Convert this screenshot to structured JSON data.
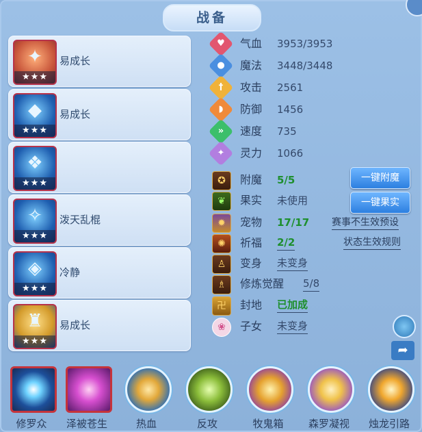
{
  "title": "战备",
  "equipment": [
    {
      "label": "易成长",
      "stars": "★★★"
    },
    {
      "label": "易成长",
      "stars": "★★★"
    },
    {
      "label": "",
      "stars": "★★★"
    },
    {
      "label": "泼天乱棍",
      "stars": "★★★"
    },
    {
      "label": "冷静",
      "stars": "★★★"
    },
    {
      "label": "易成长",
      "stars": "★★★"
    }
  ],
  "stats": [
    {
      "name": "气血",
      "value": "3953/3953",
      "color": "#e2566f",
      "icon": "heart-icon"
    },
    {
      "name": "魔法",
      "value": "3448/3448",
      "color": "#4a8fe0",
      "icon": "mana-icon"
    },
    {
      "name": "攻击",
      "value": "2561",
      "color": "#f0b23a",
      "icon": "sword-icon"
    },
    {
      "name": "防御",
      "value": "1456",
      "color": "#f08a3a",
      "icon": "shield-icon"
    },
    {
      "name": "速度",
      "value": "735",
      "color": "#3cbf6b",
      "icon": "speed-icon"
    },
    {
      "name": "灵力",
      "value": "1066",
      "color": "#b27ee0",
      "icon": "spirit-icon"
    }
  ],
  "status": [
    {
      "name": "附魔",
      "value": "5/5",
      "style": "green",
      "icon": "enchant-icon"
    },
    {
      "name": "果实",
      "value": "未使用",
      "style": "",
      "icon": "fruit-icon"
    },
    {
      "name": "宠物",
      "value": "17/17",
      "style": "green",
      "icon": "pet-icon"
    },
    {
      "name": "祈福",
      "value": "2/2",
      "style": "green-ul",
      "icon": "blessing-icon"
    },
    {
      "name": "变身",
      "value": "未变身",
      "style": "ul",
      "icon": "transform-icon"
    },
    {
      "name": "修炼觉醒",
      "value": "5/8",
      "style": "ul-right",
      "icon": "cultivation-icon"
    },
    {
      "name": "封地",
      "value": "已加成",
      "style": "green-ul",
      "icon": "fief-icon"
    },
    {
      "name": "子女",
      "value": "未变身",
      "style": "ul",
      "icon": "child-icon"
    }
  ],
  "buttons": {
    "enchant": "一键附魔",
    "fruit": "一键果实"
  },
  "links": {
    "event_presets": "赛事不生效预设",
    "status_rules": "状态生效规则"
  },
  "skills": [
    {
      "name": "修罗众",
      "frame": "square"
    },
    {
      "name": "泽被苍生",
      "frame": "square"
    },
    {
      "name": "热血",
      "frame": "circle"
    },
    {
      "name": "反攻",
      "frame": "circle"
    },
    {
      "name": "牧鬼箱",
      "frame": "circle"
    },
    {
      "name": "森罗凝视",
      "frame": "circle"
    },
    {
      "name": "烛龙引路",
      "frame": "circle"
    }
  ]
}
